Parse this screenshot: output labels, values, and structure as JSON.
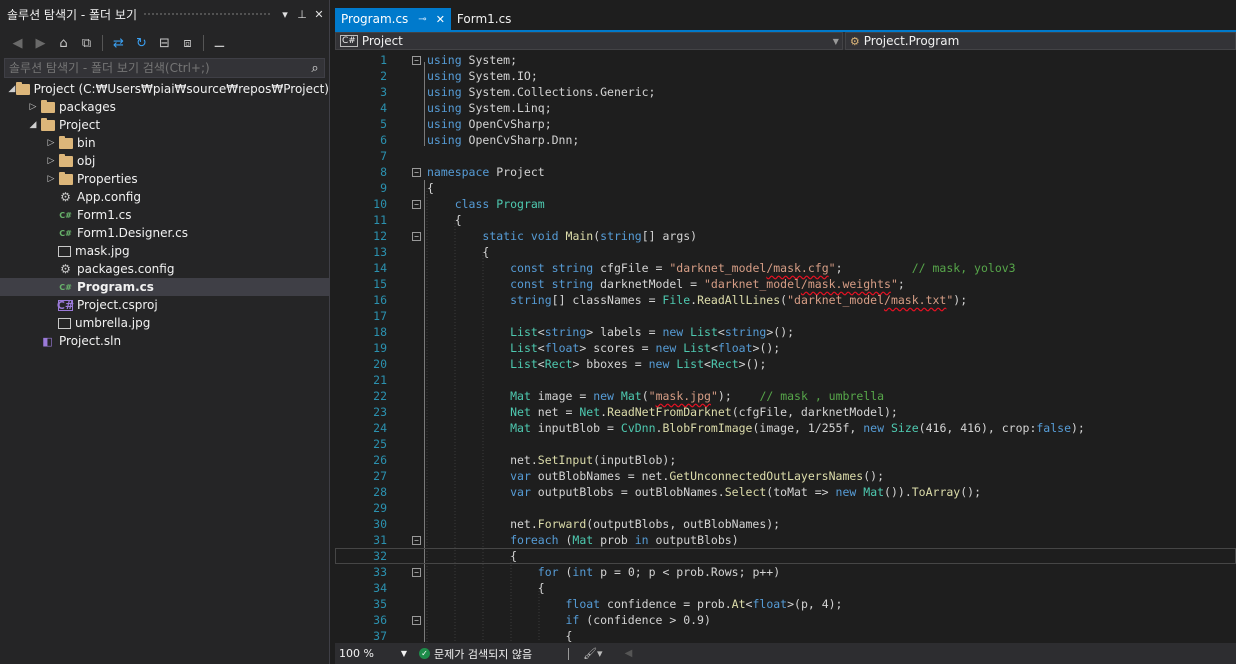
{
  "solution_explorer": {
    "title": "솔루션 탐색기 - 폴더 보기",
    "search_placeholder": "솔루션 탐색기 - 폴더 보기 검색(Ctrl+;)",
    "tree": [
      {
        "label": "Project (C:₩Users₩piai₩source₩repos₩Project)",
        "icon": "folder-open-icon"
      },
      {
        "label": "packages",
        "icon": "folder-icon"
      },
      {
        "label": "Project",
        "icon": "folder-open-icon"
      },
      {
        "label": "bin",
        "icon": "folder-icon"
      },
      {
        "label": "obj",
        "icon": "folder-icon"
      },
      {
        "label": "Properties",
        "icon": "folder-icon"
      },
      {
        "label": "App.config",
        "icon": "config-file-icon"
      },
      {
        "label": "Form1.cs",
        "icon": "csharp-file-icon"
      },
      {
        "label": "Form1.Designer.cs",
        "icon": "csharp-file-icon"
      },
      {
        "label": "mask.jpg",
        "icon": "image-file-icon"
      },
      {
        "label": "packages.config",
        "icon": "config-file-icon"
      },
      {
        "label": "Program.cs",
        "icon": "csharp-file-icon"
      },
      {
        "label": "Project.csproj",
        "icon": "csproj-file-icon"
      },
      {
        "label": "umbrella.jpg",
        "icon": "image-file-icon"
      },
      {
        "label": "Project.sln",
        "icon": "solution-file-icon"
      }
    ]
  },
  "editor": {
    "tabs": [
      {
        "label": "Program.cs",
        "active": true
      },
      {
        "label": "Form1.cs",
        "active": false
      }
    ],
    "nav_left": "Project",
    "nav_right": "Project.Program",
    "line_numbers": [
      "1",
      "2",
      "3",
      "4",
      "5",
      "6",
      "7",
      "8",
      "9",
      "10",
      "11",
      "12",
      "13",
      "14",
      "15",
      "16",
      "17",
      "18",
      "19",
      "20",
      "21",
      "22",
      "23",
      "24",
      "25",
      "26",
      "27",
      "28",
      "29",
      "30",
      "31",
      "32",
      "33",
      "34",
      "35",
      "36",
      "37"
    ]
  },
  "status": {
    "zoom": "100 %",
    "issues": "문제가 검색되지 않음"
  },
  "colors": {
    "accent": "#007acc",
    "keyword": "#569cd6",
    "type": "#4ec9b0",
    "string": "#d69d85",
    "comment": "#57a64a",
    "line_number": "#2b91af",
    "squiggle": "#e81123"
  }
}
